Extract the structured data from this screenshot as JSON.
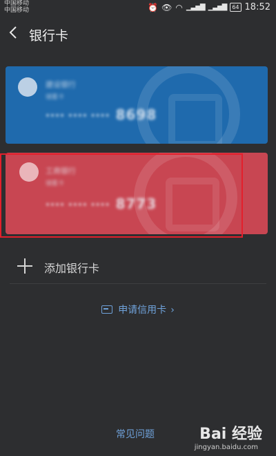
{
  "status_bar": {
    "carrier1": "中国移动",
    "carrier2": "中国移动",
    "icons": [
      "alarm-icon",
      "eye-icon",
      "wifi-icon",
      "signal-icon"
    ],
    "battery": "64",
    "time": "18:52"
  },
  "header": {
    "title": "银行卡",
    "back_icon": "chevron-left-icon"
  },
  "cards": [
    {
      "bank_name": "建设银行",
      "card_type": "储蓄卡",
      "number_masked": "**** **** ****",
      "last4": "8698",
      "color": "#1f6aad"
    },
    {
      "bank_name": "工商银行",
      "card_type": "储蓄卡",
      "number_masked": "**** **** ****",
      "last4": "8773",
      "color": "#c84652"
    }
  ],
  "add_card": {
    "label": "添加银行卡",
    "icon": "plus-icon"
  },
  "apply_credit": {
    "label": "申请信用卡",
    "icon": "credit-card-icon",
    "chevron": "›"
  },
  "footer": {
    "faq_label": "常见问题",
    "watermark_logo": "Bai 经验",
    "watermark_url": "jingyan.baidu.com"
  },
  "colors": {
    "background": "#2d2e30",
    "link": "#6fa2da",
    "highlight": "#e3202c"
  }
}
